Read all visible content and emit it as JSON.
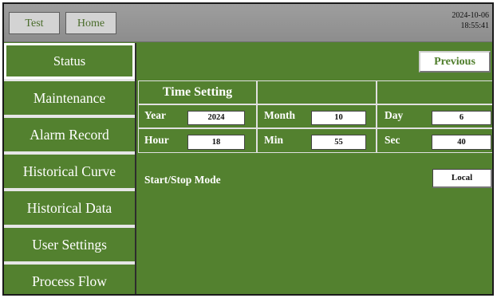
{
  "header": {
    "test_label": "Test",
    "home_label": "Home",
    "date": "2024-10-06",
    "time": "18:55:41"
  },
  "sidebar": {
    "items": [
      {
        "label": "Status",
        "active": true
      },
      {
        "label": "Maintenance",
        "active": false
      },
      {
        "label": "Alarm Record",
        "active": false
      },
      {
        "label": "Historical Curve",
        "active": false
      },
      {
        "label": "Historical Data",
        "active": false
      },
      {
        "label": "User Settings",
        "active": false
      },
      {
        "label": "Process Flow",
        "active": false
      }
    ]
  },
  "main": {
    "previous_label": "Previous",
    "time_setting": {
      "title": "Time Setting",
      "year_label": "Year",
      "year_value": "2024",
      "month_label": "Month",
      "month_value": "10",
      "day_label": "Day",
      "day_value": "6",
      "hour_label": "Hour",
      "hour_value": "18",
      "min_label": "Min",
      "min_value": "55",
      "sec_label": "Sec",
      "sec_value": "40"
    },
    "start_stop_mode_label": "Start/Stop Mode",
    "start_stop_mode_value": "Local"
  },
  "colors": {
    "panel_green": "#53812f",
    "header_gray": "#9e9e9e",
    "button_text_green": "#4e7d2a"
  }
}
